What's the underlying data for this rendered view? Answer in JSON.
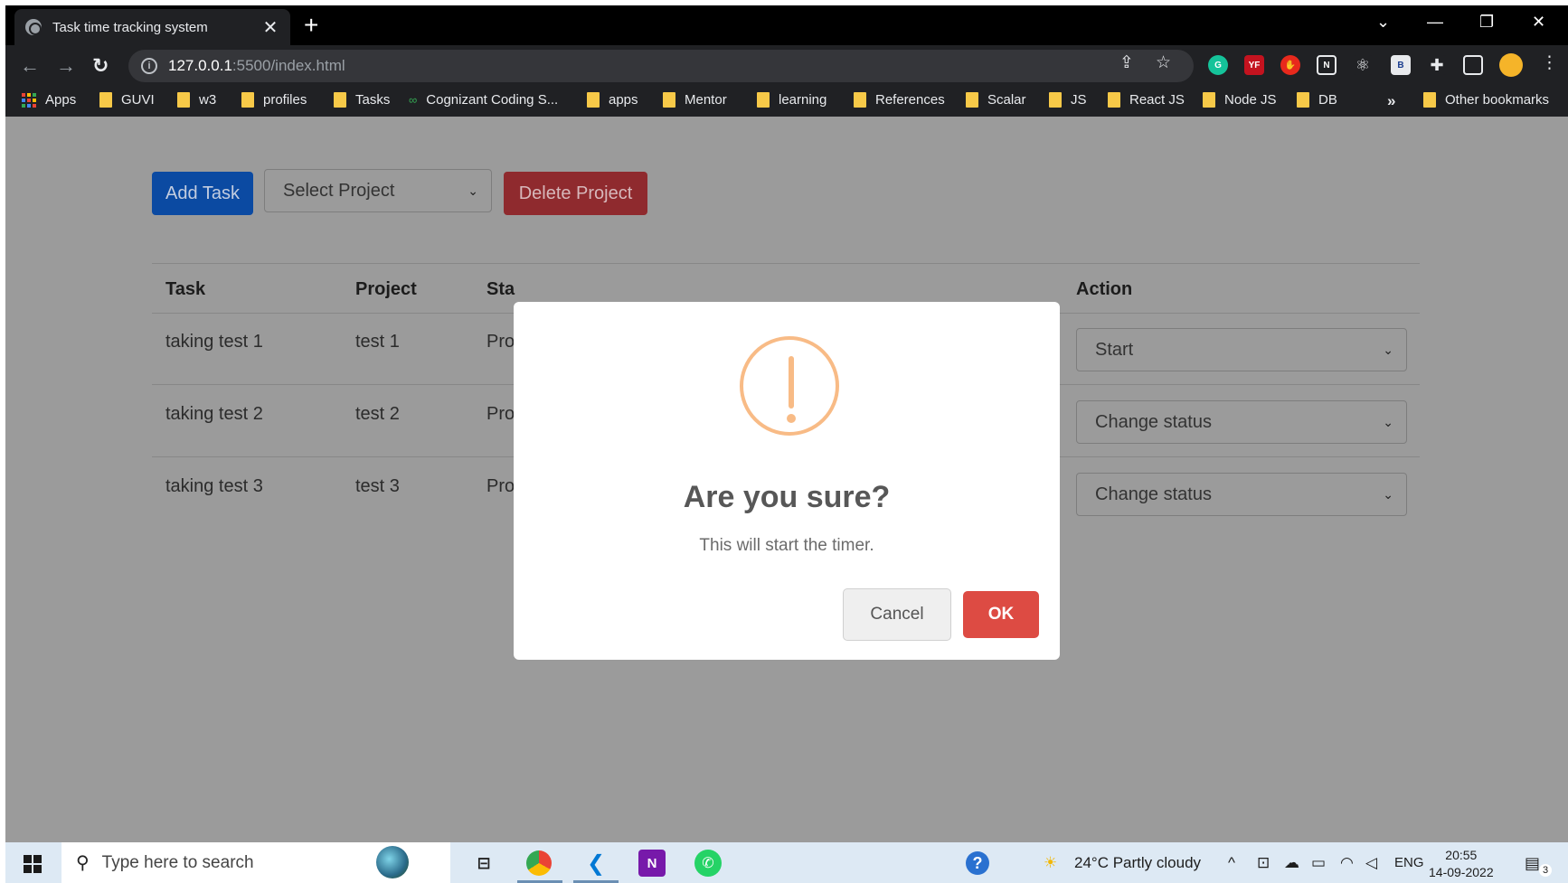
{
  "browser": {
    "tab_title": "Task time tracking system",
    "tab_close": "✕",
    "new_tab": "+",
    "url_host": "127.0.0.1",
    "url_path": ":5500/index.html",
    "bookmarks": [
      "Apps",
      "GUVI",
      "w3",
      "profiles",
      "Tasks",
      "Cognizant Coding S...",
      "apps",
      "Mentor",
      "learning",
      "References",
      "Scalar",
      "JS",
      "React JS",
      "Node JS",
      "DB"
    ],
    "more_bookmarks": "»",
    "other_bookmarks": "Other bookmarks"
  },
  "toolbar": {
    "add_task_label": "Add Task",
    "select_project_label": "Select Project",
    "delete_project_label": "Delete Project"
  },
  "table": {
    "headers": {
      "task": "Task",
      "project": "Project",
      "status": "Sta",
      "action": "Action"
    },
    "rows": [
      {
        "task": "taking test 1",
        "project": "test 1",
        "status": "Pro",
        "action": "Start"
      },
      {
        "task": "taking test 2",
        "project": "test 2",
        "status": "Pro",
        "action": "Change status"
      },
      {
        "task": "taking test 3",
        "project": "test 3",
        "status": "Pro",
        "action": "Change status"
      }
    ]
  },
  "modal": {
    "title": "Are you sure?",
    "text": "This will start the timer.",
    "cancel_label": "Cancel",
    "ok_label": "OK",
    "icon": "warning-icon",
    "icon_color": "#f8bb86",
    "ok_color": "#dd4b43"
  },
  "taskbar": {
    "search_placeholder": "Type here to search",
    "weather": "24°C  Partly cloudy",
    "language": "ENG",
    "time": "20:55",
    "date": "14-09-2022",
    "notifications": "3"
  },
  "colors": {
    "add_button": "#0b4aa2",
    "delete_button": "#8f2a2e",
    "overlay": "#9b9b9b"
  }
}
